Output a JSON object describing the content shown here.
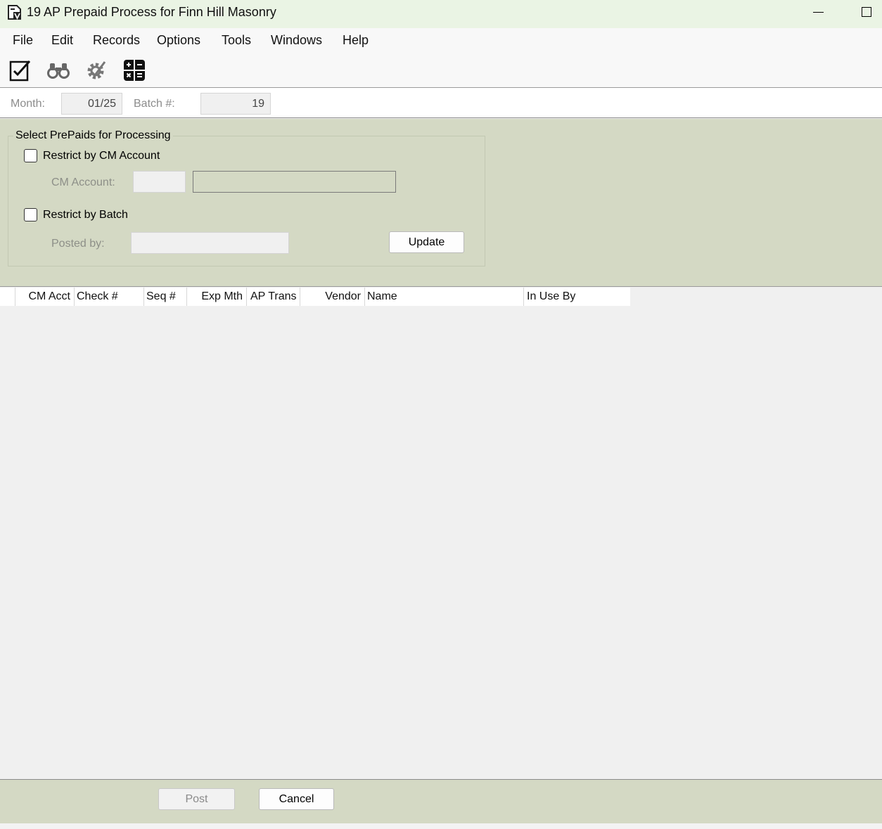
{
  "window": {
    "title": "19 AP Prepaid Process for Finn Hill Masonry",
    "app_icon": "document-v-icon",
    "minimize_icon": "minimize-icon",
    "maximize_icon": "maximize-icon"
  },
  "menu": {
    "items": [
      "File",
      "Edit",
      "Records",
      "Options",
      "Tools",
      "Windows",
      "Help"
    ]
  },
  "toolbar": {
    "icons": [
      "edit-checklist-icon",
      "binoculars-icon",
      "settings-gear-icon",
      "calculator-icon"
    ]
  },
  "header": {
    "month_label": "Month:",
    "month_value": "01/25",
    "batch_label": "Batch #:",
    "batch_value": "19"
  },
  "filters": {
    "group_title": "Select PrePaids for Processing",
    "restrict_cm_label": "Restrict by CM Account",
    "restrict_cm_checked": false,
    "cm_account_label": "CM Account:",
    "cm_account_value": "",
    "cm_account_name": "",
    "restrict_batch_label": "Restrict by Batch",
    "restrict_batch_checked": false,
    "posted_by_label": "Posted by:",
    "posted_by_value": "",
    "update_label": "Update"
  },
  "grid": {
    "columns": [
      "CM Acct",
      "Check #",
      "Seq #",
      "Exp Mth",
      "AP Trans",
      "Vendor",
      "Name",
      "In Use By"
    ],
    "rows": []
  },
  "footer": {
    "post_label": "Post",
    "cancel_label": "Cancel"
  },
  "colors": {
    "panel_green": "#d4d9c4",
    "titlebar": "#eaf4e4",
    "grid_background": "#f0f0f0"
  }
}
